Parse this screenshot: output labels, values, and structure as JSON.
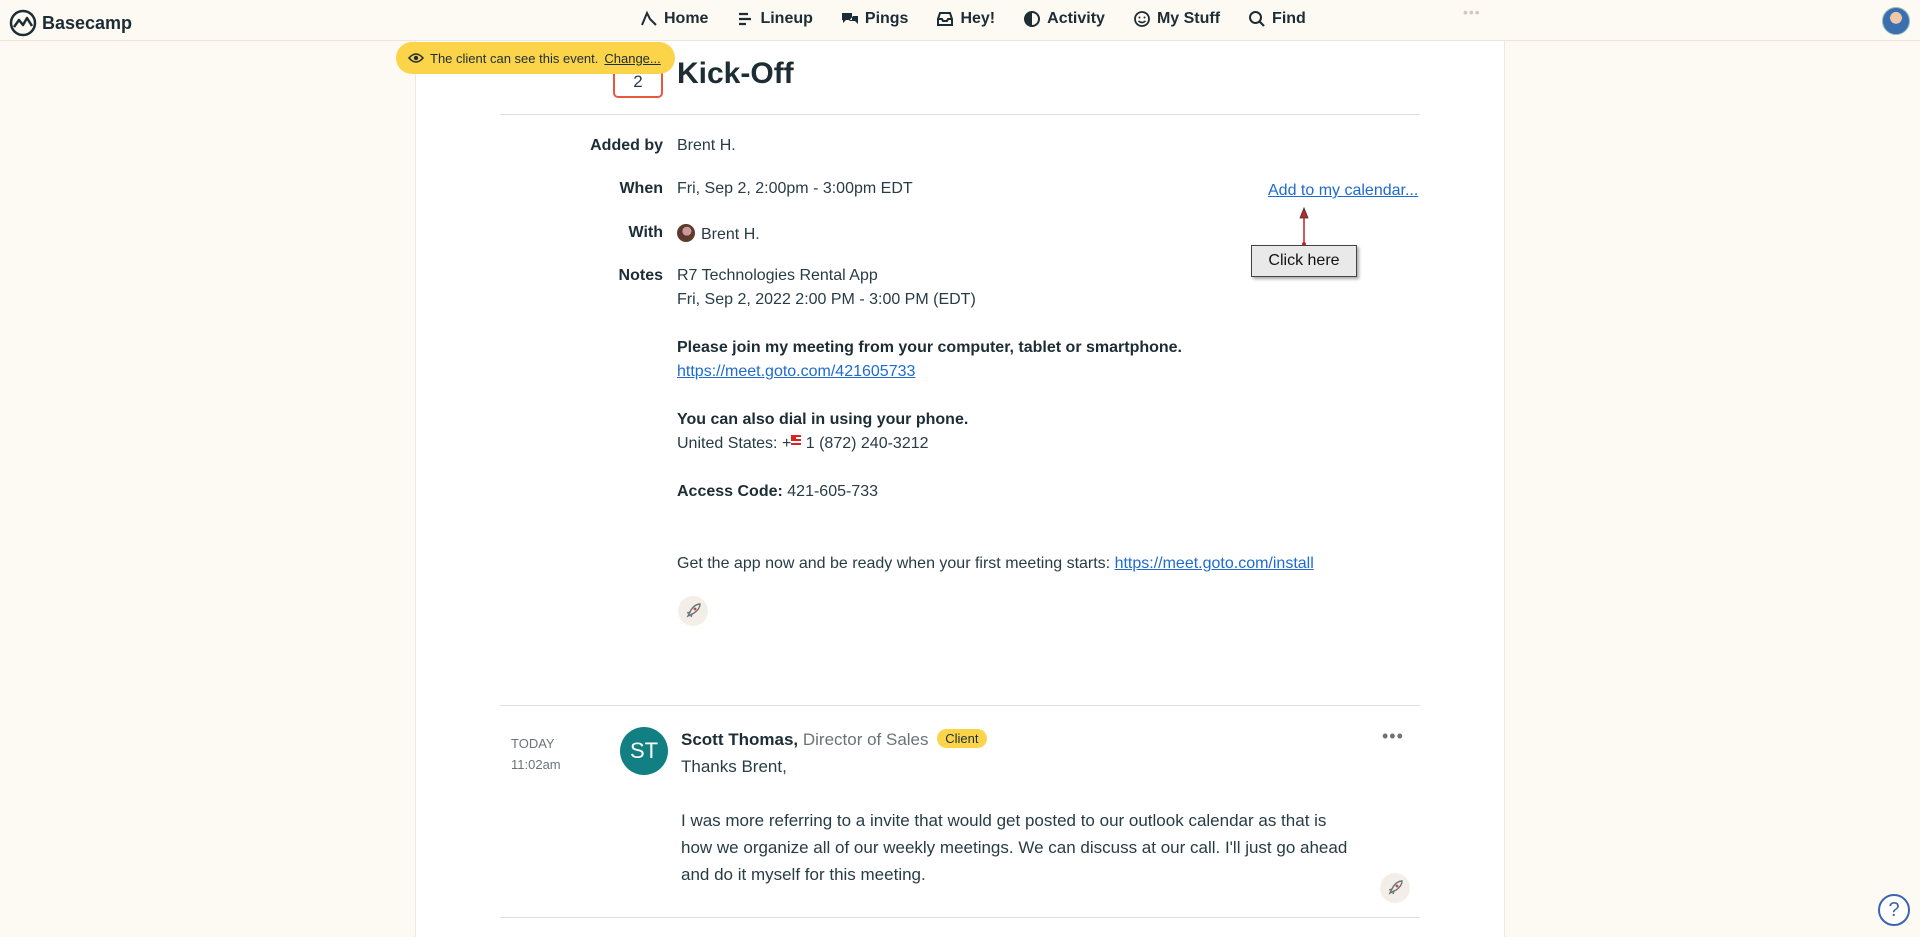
{
  "app": {
    "name": "Basecamp"
  },
  "nav": {
    "items": [
      {
        "label": "Home",
        "icon": "home-icon"
      },
      {
        "label": "Lineup",
        "icon": "lineup-icon"
      },
      {
        "label": "Pings",
        "icon": "pings-icon"
      },
      {
        "label": "Hey!",
        "icon": "hey-icon"
      },
      {
        "label": "Activity",
        "icon": "activity-icon"
      },
      {
        "label": "My Stuff",
        "icon": "my-stuff-icon"
      },
      {
        "label": "Find",
        "icon": "search-icon"
      }
    ],
    "more": "•••"
  },
  "banner": {
    "text": "The client can see this event.",
    "link": "Change..."
  },
  "event": {
    "day": "2",
    "title": "Kick-Off",
    "added_by_label": "Added by",
    "added_by": "Brent H.",
    "when_label": "When",
    "when": "Fri, Sep 2, 2:00pm - 3:00pm EDT",
    "with_label": "With",
    "with": "Brent H.",
    "add_to_calendar": "Add to my calendar...",
    "click_here": "Click here",
    "notes_label": "Notes",
    "notes": {
      "line1": "R7 Technologies Rental App",
      "line2": "Fri, Sep 2, 2022 2:00 PM - 3:00 PM (EDT)",
      "join_heading": "Please join my meeting from your computer, tablet or smartphone.",
      "join_link": "https://meet.goto.com/421605733",
      "dial_heading": "You can also dial in using your phone.",
      "dial_prefix": "United States: +",
      "dial_number": "1 (872) 240-3212",
      "access_label": "Access Code:",
      "access_code": "421-605-733",
      "app_text": "Get the app now and be ready when your first meeting starts:",
      "app_link": "https://meet.goto.com/install"
    }
  },
  "comment": {
    "date": "TODAY",
    "time": "11:02am",
    "initials": "ST",
    "author": "Scott Thomas,",
    "role": "Director of Sales",
    "badge": "Client",
    "more": "•••",
    "greeting": "Thanks Brent,",
    "line1": "I was more referring to a invite that would get posted to our outlook calendar as that is",
    "line2": "how we organize all of our weekly meetings. We can discuss at our call. I'll just go ahead",
    "line3": "and do it myself for this meeting."
  },
  "help": "?"
}
